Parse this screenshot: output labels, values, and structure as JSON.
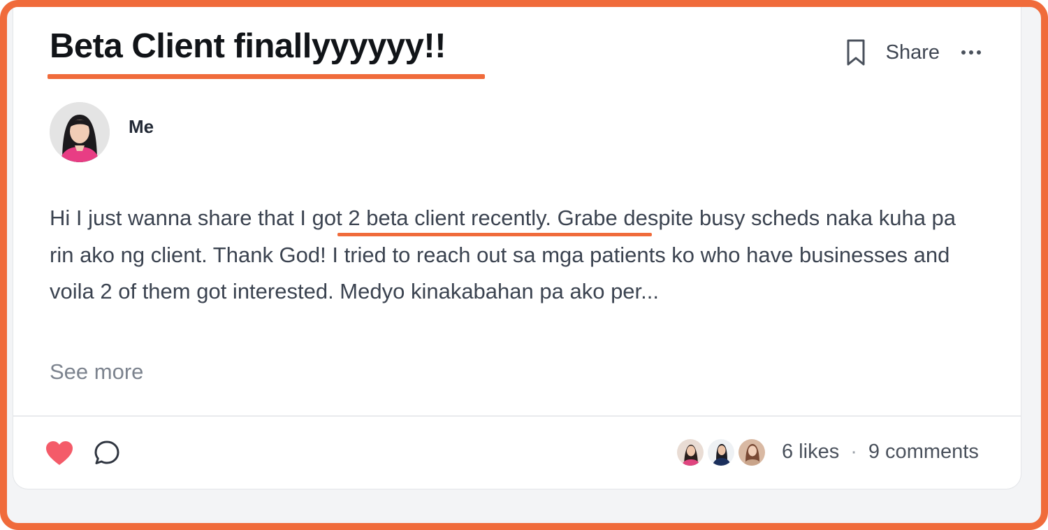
{
  "post": {
    "title": "Beta Client finallyyyyyy!!",
    "author_name": "Me",
    "body_start": "Hi I just wanna share that ",
    "body_highlight": "I got 2 beta client recently.",
    "body_rest": " Grabe despite busy scheds naka kuha pa rin ako ng client. Thank God! I tried to reach out sa mga patients ko who have businesses and voila 2 of them got interested. Medyo kinakabahan pa ako per...",
    "see_more_label": "See more"
  },
  "actions": {
    "bookmark_icon": "bookmark-icon",
    "share_label": "Share",
    "more_icon": "more-horizontal-icon"
  },
  "footer": {
    "like_icon": "heart-icon",
    "comment_icon": "comment-icon",
    "likes_text": "6 likes",
    "separator": "·",
    "comments_text": "9 comments"
  },
  "colors": {
    "accent": "#f06b3b",
    "heart": "#f45b69",
    "title": "#111418",
    "body": "#3b4350",
    "muted": "#7c838e"
  }
}
